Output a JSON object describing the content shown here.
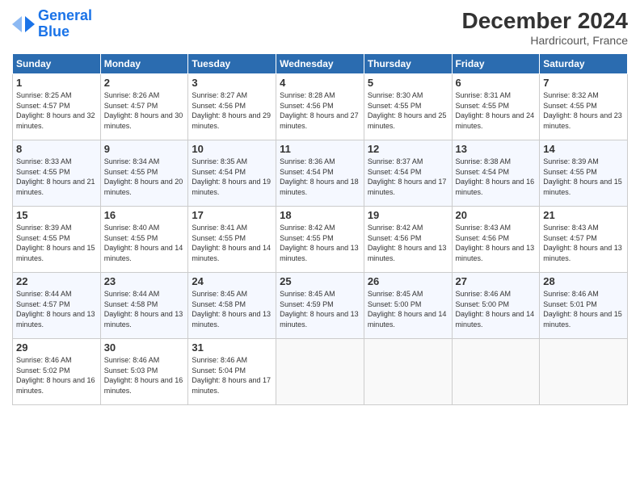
{
  "logo": {
    "line1": "General",
    "line2": "Blue"
  },
  "title": "December 2024",
  "location": "Hardricourt, France",
  "days_of_week": [
    "Sunday",
    "Monday",
    "Tuesday",
    "Wednesday",
    "Thursday",
    "Friday",
    "Saturday"
  ],
  "weeks": [
    [
      {
        "day": 1,
        "sunrise": "8:25 AM",
        "sunset": "4:57 PM",
        "daylight": "8 hours and 32 minutes"
      },
      {
        "day": 2,
        "sunrise": "8:26 AM",
        "sunset": "4:57 PM",
        "daylight": "8 hours and 30 minutes"
      },
      {
        "day": 3,
        "sunrise": "8:27 AM",
        "sunset": "4:56 PM",
        "daylight": "8 hours and 29 minutes"
      },
      {
        "day": 4,
        "sunrise": "8:28 AM",
        "sunset": "4:56 PM",
        "daylight": "8 hours and 27 minutes"
      },
      {
        "day": 5,
        "sunrise": "8:30 AM",
        "sunset": "4:55 PM",
        "daylight": "8 hours and 25 minutes"
      },
      {
        "day": 6,
        "sunrise": "8:31 AM",
        "sunset": "4:55 PM",
        "daylight": "8 hours and 24 minutes"
      },
      {
        "day": 7,
        "sunrise": "8:32 AM",
        "sunset": "4:55 PM",
        "daylight": "8 hours and 23 minutes"
      }
    ],
    [
      {
        "day": 8,
        "sunrise": "8:33 AM",
        "sunset": "4:55 PM",
        "daylight": "8 hours and 21 minutes"
      },
      {
        "day": 9,
        "sunrise": "8:34 AM",
        "sunset": "4:55 PM",
        "daylight": "8 hours and 20 minutes"
      },
      {
        "day": 10,
        "sunrise": "8:35 AM",
        "sunset": "4:54 PM",
        "daylight": "8 hours and 19 minutes"
      },
      {
        "day": 11,
        "sunrise": "8:36 AM",
        "sunset": "4:54 PM",
        "daylight": "8 hours and 18 minutes"
      },
      {
        "day": 12,
        "sunrise": "8:37 AM",
        "sunset": "4:54 PM",
        "daylight": "8 hours and 17 minutes"
      },
      {
        "day": 13,
        "sunrise": "8:38 AM",
        "sunset": "4:54 PM",
        "daylight": "8 hours and 16 minutes"
      },
      {
        "day": 14,
        "sunrise": "8:39 AM",
        "sunset": "4:55 PM",
        "daylight": "8 hours and 15 minutes"
      }
    ],
    [
      {
        "day": 15,
        "sunrise": "8:39 AM",
        "sunset": "4:55 PM",
        "daylight": "8 hours and 15 minutes"
      },
      {
        "day": 16,
        "sunrise": "8:40 AM",
        "sunset": "4:55 PM",
        "daylight": "8 hours and 14 minutes"
      },
      {
        "day": 17,
        "sunrise": "8:41 AM",
        "sunset": "4:55 PM",
        "daylight": "8 hours and 14 minutes"
      },
      {
        "day": 18,
        "sunrise": "8:42 AM",
        "sunset": "4:55 PM",
        "daylight": "8 hours and 13 minutes"
      },
      {
        "day": 19,
        "sunrise": "8:42 AM",
        "sunset": "4:56 PM",
        "daylight": "8 hours and 13 minutes"
      },
      {
        "day": 20,
        "sunrise": "8:43 AM",
        "sunset": "4:56 PM",
        "daylight": "8 hours and 13 minutes"
      },
      {
        "day": 21,
        "sunrise": "8:43 AM",
        "sunset": "4:57 PM",
        "daylight": "8 hours and 13 minutes"
      }
    ],
    [
      {
        "day": 22,
        "sunrise": "8:44 AM",
        "sunset": "4:57 PM",
        "daylight": "8 hours and 13 minutes"
      },
      {
        "day": 23,
        "sunrise": "8:44 AM",
        "sunset": "4:58 PM",
        "daylight": "8 hours and 13 minutes"
      },
      {
        "day": 24,
        "sunrise": "8:45 AM",
        "sunset": "4:58 PM",
        "daylight": "8 hours and 13 minutes"
      },
      {
        "day": 25,
        "sunrise": "8:45 AM",
        "sunset": "4:59 PM",
        "daylight": "8 hours and 13 minutes"
      },
      {
        "day": 26,
        "sunrise": "8:45 AM",
        "sunset": "5:00 PM",
        "daylight": "8 hours and 14 minutes"
      },
      {
        "day": 27,
        "sunrise": "8:46 AM",
        "sunset": "5:00 PM",
        "daylight": "8 hours and 14 minutes"
      },
      {
        "day": 28,
        "sunrise": "8:46 AM",
        "sunset": "5:01 PM",
        "daylight": "8 hours and 15 minutes"
      }
    ],
    [
      {
        "day": 29,
        "sunrise": "8:46 AM",
        "sunset": "5:02 PM",
        "daylight": "8 hours and 16 minutes"
      },
      {
        "day": 30,
        "sunrise": "8:46 AM",
        "sunset": "5:03 PM",
        "daylight": "8 hours and 16 minutes"
      },
      {
        "day": 31,
        "sunrise": "8:46 AM",
        "sunset": "5:04 PM",
        "daylight": "8 hours and 17 minutes"
      },
      null,
      null,
      null,
      null
    ]
  ]
}
